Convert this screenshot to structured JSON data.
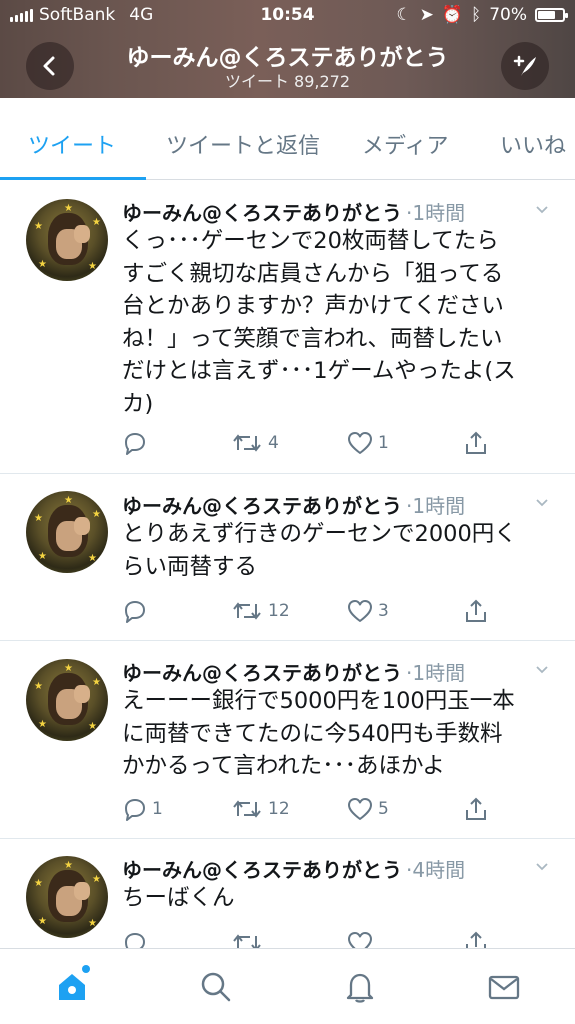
{
  "status_bar": {
    "carrier": "SoftBank",
    "network": "4G",
    "time": "10:54",
    "battery": "70%",
    "battery_level": 0.7
  },
  "header": {
    "title": "ゆーみん@くろステありがとう",
    "subtitle": "ツイート 89,272"
  },
  "tabs": [
    {
      "label": "ツイート",
      "active": true
    },
    {
      "label": "ツイートと返信",
      "active": false
    },
    {
      "label": "メディア",
      "active": false
    },
    {
      "label": "いいね",
      "active": false
    }
  ],
  "tweets": [
    {
      "name": "ゆーみん@くろステありがとう",
      "time": "·1時間",
      "lines": [
        "くっ･･･ゲーセンで20枚両替してたら",
        "すごく親切な店員さんから「狙ってる",
        "台とかありますか？声かけてください",
        "ね！」って笑顔で言われ、両替したい",
        "だけとは言えず･･･1ゲームやったよ(ス",
        "カ)"
      ],
      "replies": "",
      "retweets": "4",
      "likes": "1"
    },
    {
      "name": "ゆーみん@くろステありがとう",
      "time": "·1時間",
      "lines": [
        "とりあえず行きのゲーセンで2000円く",
        "らい両替する"
      ],
      "replies": "",
      "retweets": "12",
      "likes": "3"
    },
    {
      "name": "ゆーみん@くろステありがとう",
      "time": "·1時間",
      "lines": [
        "えーーー銀行で5000円を100円玉一本",
        "に両替できてたのに今540円も手数料",
        "かかるって言われた･･･あほかよ"
      ],
      "replies": "1",
      "retweets": "12",
      "likes": "5"
    },
    {
      "name": "ゆーみん@くろステありがとう",
      "time": "·4時間",
      "lines": [
        "ちーばくん"
      ],
      "replies": "",
      "retweets": "",
      "likes": ""
    }
  ],
  "colors": {
    "accent": "#1da1f2",
    "muted": "#657786",
    "time": "#8899a6"
  }
}
